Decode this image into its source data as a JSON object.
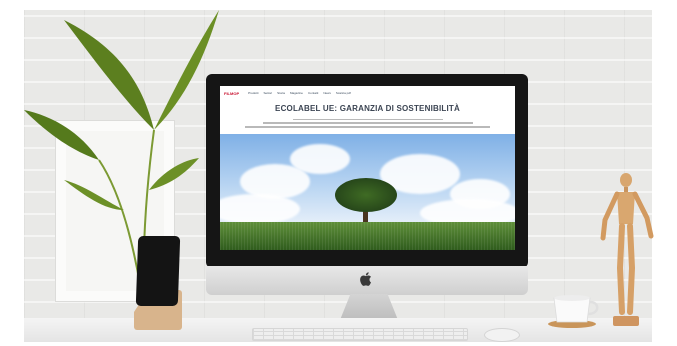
{
  "site": {
    "logo": "FILMOP",
    "nav": [
      "Prodotti",
      "Settori",
      "Storia",
      "Magazine",
      "Contatti",
      "News",
      "Scarica pdf"
    ],
    "title": "ECOLABEL UE: GARANZIA DI SOSTENIBILITÀ"
  },
  "colors": {
    "wall": "#e9e9e7",
    "sky_top": "#7fb0e6",
    "grass": "#3f6e26",
    "title_text": "#3c4553",
    "logo_red": "#c8102e"
  },
  "icons": [
    "apple-logo-icon"
  ]
}
